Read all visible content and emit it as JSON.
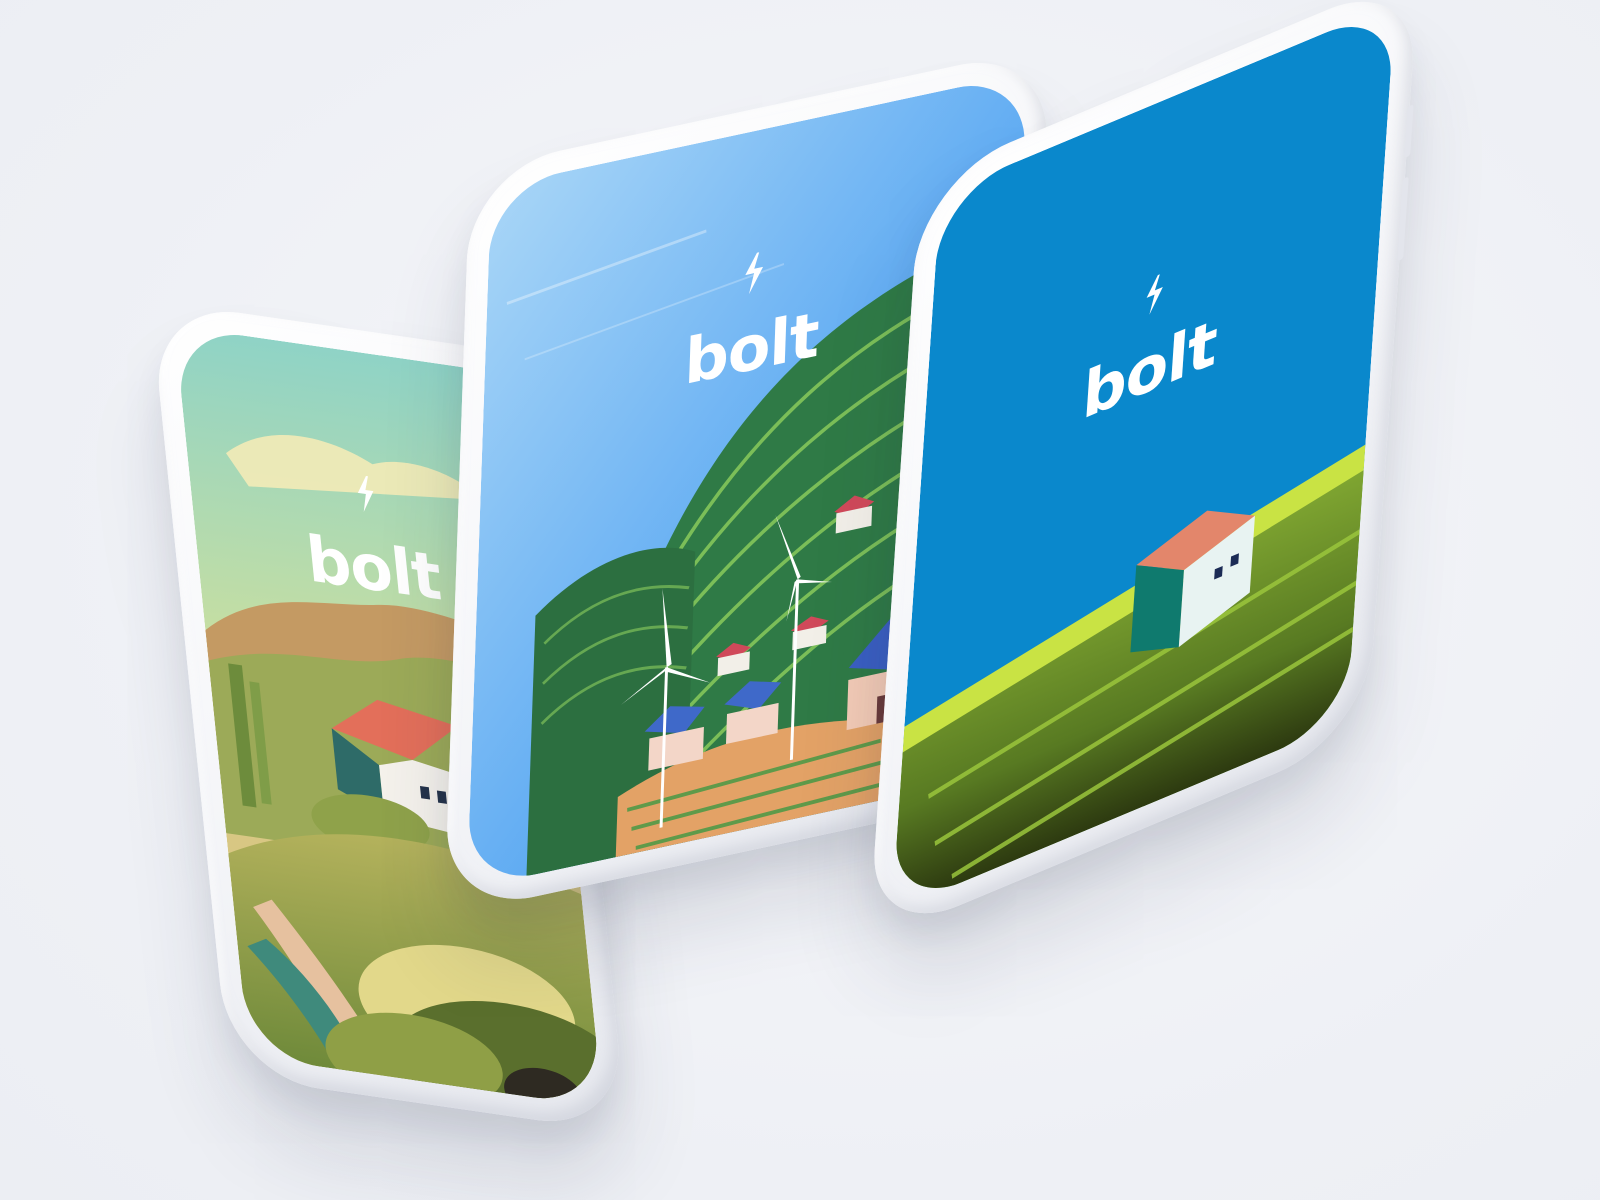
{
  "screens": [
    {
      "brand_name": "bolt",
      "logo_icon": "lightning-bolt-icon",
      "theme": "painted-countryside",
      "colors": {
        "sky": "#8fd3c6",
        "accent": "#e36f5a",
        "field": "#8fa24a"
      }
    },
    {
      "brand_name": "bolt",
      "logo_icon": "lightning-bolt-icon",
      "theme": "green-hills-wind-turbines",
      "colors": {
        "sky": "#5aa8f2",
        "accent": "#e7887a",
        "field": "#2f7a46"
      }
    },
    {
      "brand_name": "bolt",
      "logo_icon": "lightning-bolt-icon",
      "theme": "flat-blue-sky-house",
      "colors": {
        "sky": "#0a88cc",
        "accent": "#e3866b",
        "field": "#6a8f22"
      }
    }
  ]
}
